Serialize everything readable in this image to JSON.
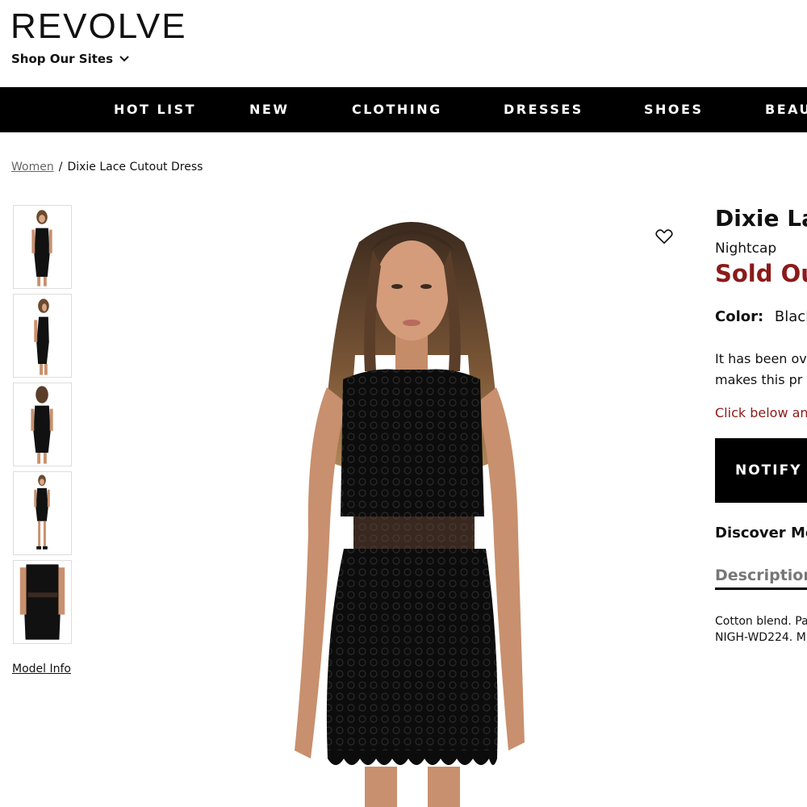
{
  "header": {
    "logo": "REVOLVE",
    "shop_sites": "Shop Our Sites"
  },
  "nav": {
    "items": [
      "HOT LIST",
      "NEW",
      "CLOTHING",
      "DRESSES",
      "SHOES",
      "BEAU"
    ]
  },
  "breadcrumb": {
    "link": "Women",
    "separator": "/",
    "current": "Dixie Lace Cutout Dress"
  },
  "gallery": {
    "thumbnail_count": 5,
    "model_info": "Model Info"
  },
  "product": {
    "title": "Dixie La",
    "brand": "Nightcap",
    "status": "Sold Out",
    "color_label": "Color:",
    "color_value": "Black",
    "message_line1": "It has been ov",
    "message_line2": "makes this pr",
    "click_below": "Click below an",
    "notify_button": "NOTIFY",
    "discover": "Discover Mo",
    "description_tab": "Description",
    "description_line1": "Cotton blend. Pa",
    "description_line2": "NIGH-WD224. M"
  },
  "colors": {
    "accent_red": "#8b1a1a",
    "nav_bg": "#000000"
  },
  "icons": {
    "shop_sites": "chevron-down-icon",
    "favorite": "heart-icon"
  }
}
